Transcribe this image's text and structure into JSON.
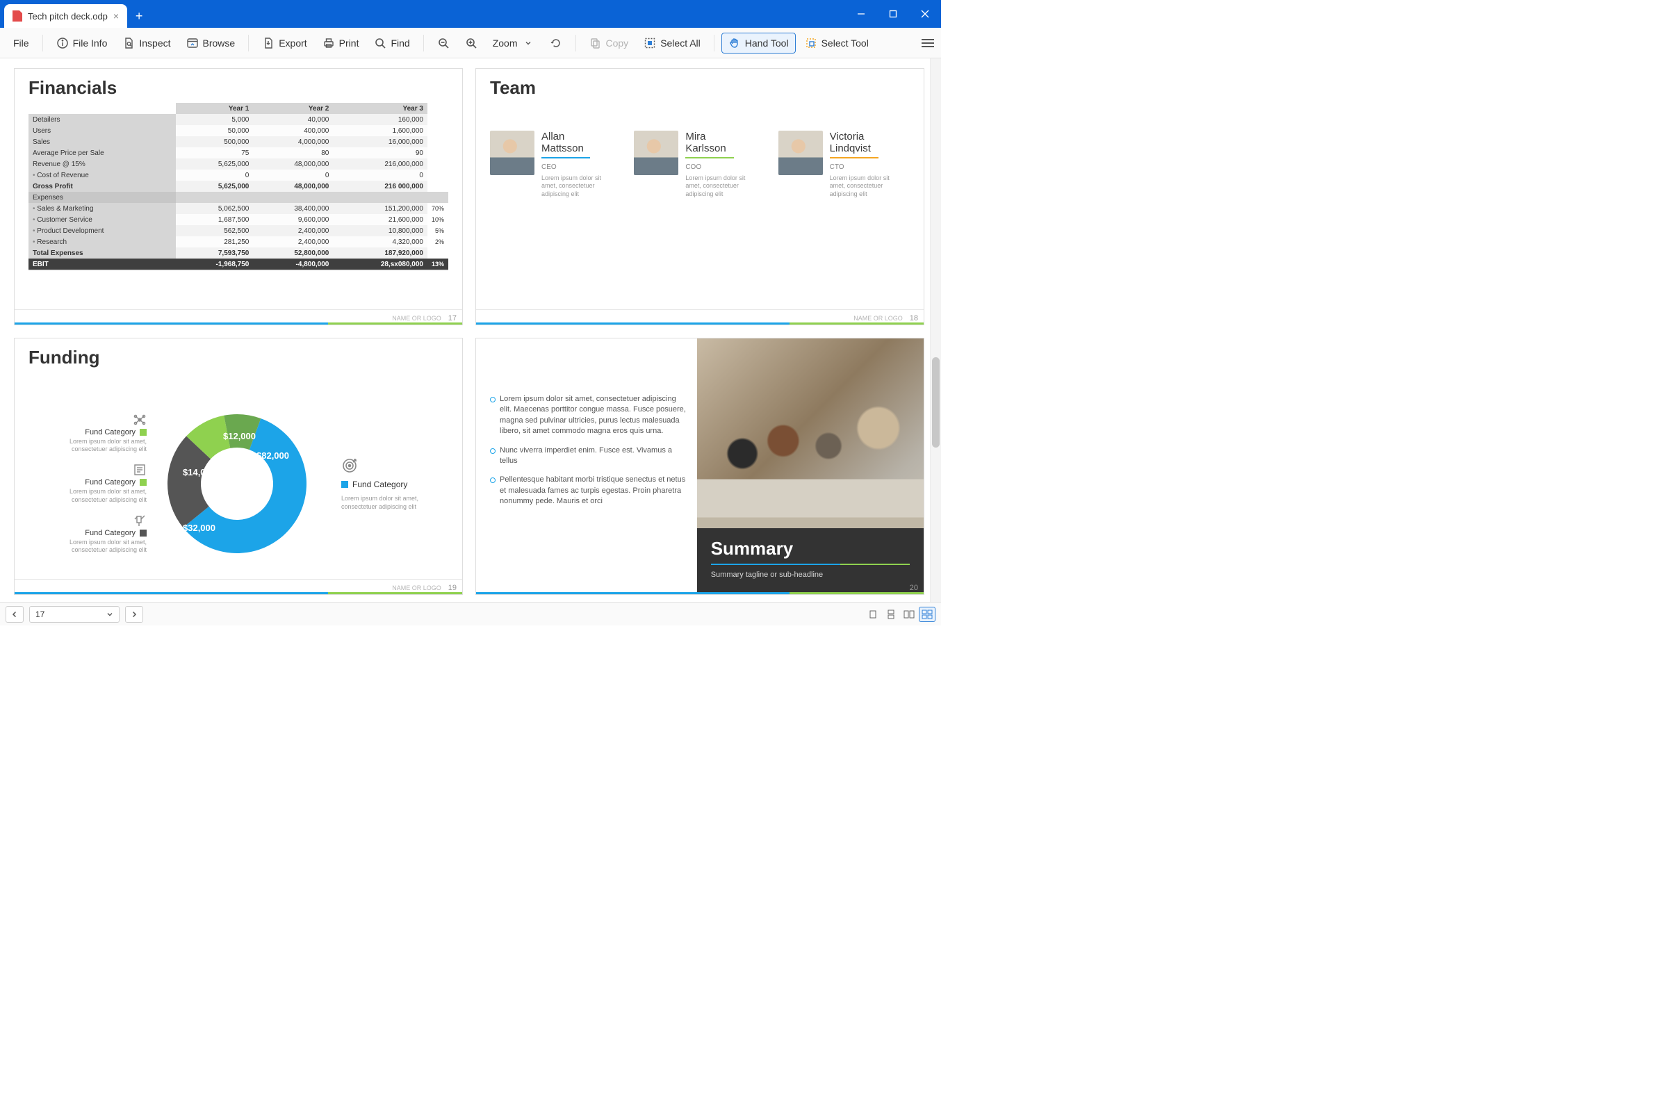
{
  "window": {
    "title": "Tech pitch deck.odp"
  },
  "menu": {
    "file": "File"
  },
  "toolbar": {
    "file_info": "File Info",
    "inspect": "Inspect",
    "browse": "Browse",
    "export": "Export",
    "print": "Print",
    "find": "Find",
    "zoom": "Zoom",
    "copy": "Copy",
    "select_all": "Select All",
    "hand_tool": "Hand Tool",
    "select_tool": "Select Tool"
  },
  "slide_footer_label": "NAME OR LOGO",
  "slides": {
    "financials": {
      "title": "Financials",
      "page": "17",
      "col_labels": [
        "",
        "Year 1",
        "Year 2",
        "Year 3"
      ],
      "rows": [
        {
          "label": "Detailers",
          "y1": "5,000",
          "y2": "40,000",
          "y3": "160,000"
        },
        {
          "label": "Users",
          "y1": "50,000",
          "y2": "400,000",
          "y3": "1,600,000"
        },
        {
          "label": "Sales",
          "y1": "500,000",
          "y2": "4,000,000",
          "y3": "16,000,000"
        },
        {
          "label": "Average Price per Sale",
          "y1": "75",
          "y2": "80",
          "y3": "90"
        },
        {
          "label": "Revenue @ 15%",
          "y1": "5,625,000",
          "y2": "48,000,000",
          "y3": "216,000,000"
        },
        {
          "label": "Cost of Revenue",
          "indent": true,
          "y1": "0",
          "y2": "0",
          "y3": "0"
        },
        {
          "label": "Gross Profit",
          "bold": true,
          "y1": "5,625,000",
          "y2": "48,000,000",
          "y3": "216 000,000"
        },
        {
          "label": "Expenses",
          "section": true
        },
        {
          "label": "Sales & Marketing",
          "indent": true,
          "y1": "5,062,500",
          "y2": "38,400,000",
          "y3": "151,200,000",
          "pct": "70%"
        },
        {
          "label": "Customer Service",
          "indent": true,
          "y1": "1,687,500",
          "y2": "9,600,000",
          "y3": "21,600,000",
          "pct": "10%"
        },
        {
          "label": "Product Development",
          "indent": true,
          "y1": "562,500",
          "y2": "2,400,000",
          "y3": "10,800,000",
          "pct": "5%"
        },
        {
          "label": "Research",
          "indent": true,
          "y1": "281,250",
          "y2": "2,400,000",
          "y3": "4,320,000",
          "pct": "2%"
        },
        {
          "label": "Total Expenses",
          "bold": true,
          "y1": "7,593,750",
          "y2": "52,800,000",
          "y3": "187,920,000"
        },
        {
          "label": "EBIT",
          "ebit": true,
          "y1": "-1,968,750",
          "y2": "-4,800,000",
          "y3": "28,sx080,000",
          "pct": "13%"
        }
      ]
    },
    "team": {
      "title": "Team",
      "page": "18",
      "members": [
        {
          "name": "Allan Mattsson",
          "role": "CEO",
          "rule": "#1ca4e8",
          "desc": "Lorem ipsum dolor sit amet, consectetuer adipiscing elit"
        },
        {
          "name": "Mira Karlsson",
          "role": "COO",
          "rule": "#8fd14f",
          "desc": "Lorem ipsum dolor sit amet, consectetuer adipiscing elit"
        },
        {
          "name": "Victoria Lindqvist",
          "role": "CTO",
          "rule": "#f5a623",
          "desc": "Lorem ipsum dolor sit amet, consectetuer adipiscing elit"
        }
      ]
    },
    "funding": {
      "title": "Funding",
      "page": "19",
      "left": [
        {
          "label": "Fund Category",
          "swatch": "#8fd14f",
          "desc": "Lorem ipsum dolor sit amet, consectetuer adipiscing elit"
        },
        {
          "label": "Fund Category",
          "swatch": "#8fd14f",
          "desc": "Lorem ipsum dolor sit amet, consectetuer adipiscing elit"
        },
        {
          "label": "Fund Category",
          "swatch": "#555555",
          "desc": "Lorem ipsum dolor sit amet, consectetuer adipiscing elit"
        }
      ],
      "right": {
        "label": "Fund Category",
        "swatch": "#1ca4e8",
        "desc": "Lorem ipsum dolor sit amet, consectetuer adipiscing elit"
      },
      "labels": {
        "a": "$12,000",
        "b": "$82,000",
        "c": "$14,000",
        "d": "$32,000"
      }
    },
    "summary": {
      "page": "20",
      "heading": "Summary",
      "tagline": "Summary tagline or sub-headline",
      "bullets": [
        "Lorem ipsum dolor sit amet, consectetuer adipiscing elit. Maecenas porttitor congue massa. Fusce posuere, magna sed pulvinar ultricies, purus lectus malesuada libero, sit amet commodo magna eros quis urna.",
        "Nunc viverra imperdiet enim. Fusce est. Vivamus a tellus",
        "Pellentesque habitant morbi tristique senectus et netus et malesuada fames ac turpis egestas. Proin pharetra nonummy pede. Mauris et orci"
      ]
    }
  },
  "status": {
    "page": "17"
  },
  "chart_data": {
    "type": "pie",
    "title": "Funding",
    "series": [
      {
        "name": "Fund Category",
        "value": 82000,
        "color": "#1ca4e8",
        "label": "$82,000"
      },
      {
        "name": "Fund Category",
        "value": 32000,
        "color": "#555555",
        "label": "$32,000"
      },
      {
        "name": "Fund Category",
        "value": 14000,
        "color": "#8fd14f",
        "label": "$14,000"
      },
      {
        "name": "Fund Category",
        "value": 12000,
        "color": "#6aa84f",
        "label": "$12,000"
      }
    ],
    "donut": true
  }
}
